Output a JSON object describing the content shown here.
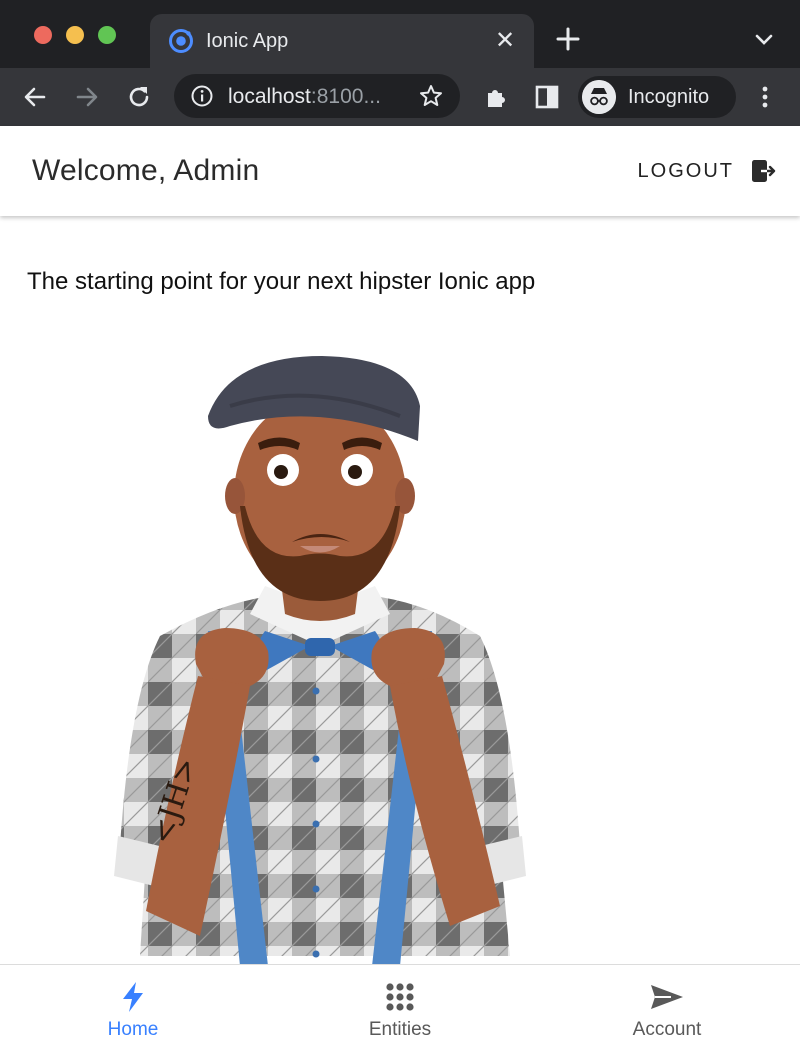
{
  "browser": {
    "tab": {
      "title": "Ionic App",
      "favicon": "ionic-logo-icon",
      "close_glyph": "✕"
    },
    "omnibox": {
      "url_host": "localhost",
      "url_rest": ":8100..."
    },
    "profile": {
      "label": "Incognito",
      "icon": "incognito-icon"
    }
  },
  "header": {
    "title": "Welcome, Admin",
    "logout_label": "LOGOUT",
    "logout_icon": "log-out-icon"
  },
  "main": {
    "tagline": "The starting point for your next hipster Ionic app",
    "illustration": {
      "tattoo_text": "<JH>"
    }
  },
  "tabbar": {
    "tabs": [
      {
        "label": "Home",
        "icon": "flash-icon",
        "active": true
      },
      {
        "label": "Entities",
        "icon": "apps-grid-icon",
        "active": false
      },
      {
        "label": "Account",
        "icon": "send-icon",
        "active": false
      }
    ]
  },
  "colors": {
    "accent": "#3880ff",
    "chrome_dark": "#202124",
    "chrome_mid": "#35363a",
    "tab_inactive": "#595959"
  }
}
